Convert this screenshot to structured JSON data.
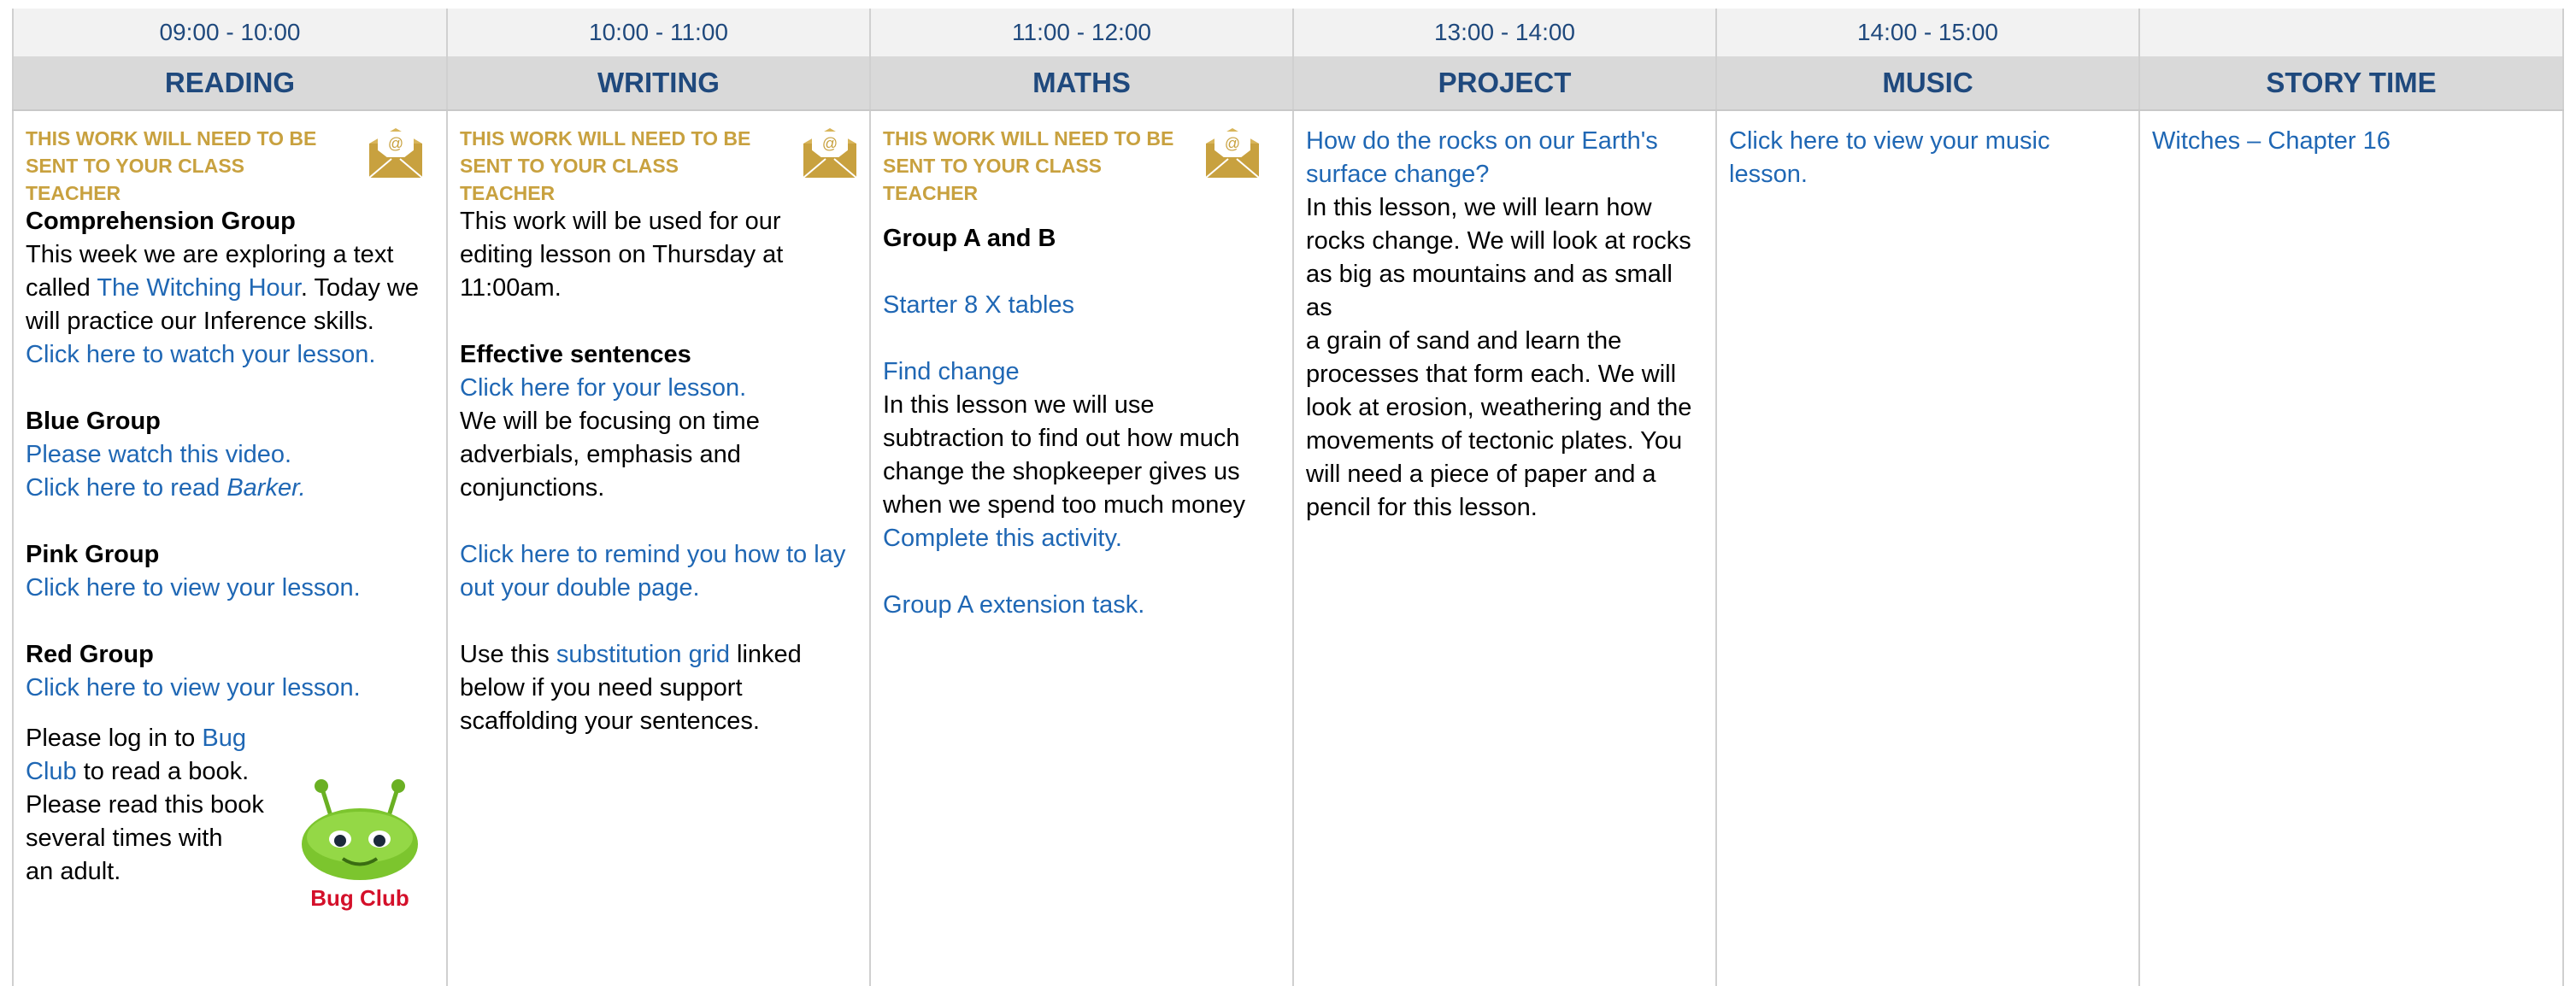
{
  "times": [
    "09:00 - 10:00",
    "10:00 - 11:00",
    "11:00 - 12:00",
    "13:00 - 14:00",
    "14:00 - 15:00",
    ""
  ],
  "subjects": [
    "READING",
    "WRITING",
    "MATHS",
    "PROJECT",
    "MUSIC",
    "STORY TIME"
  ],
  "notice_line1": "THIS WORK WILL NEED TO BE",
  "notice_line2": "SENT TO YOUR CLASS TEACHER",
  "icons": {
    "envelope": "envelope-at-icon",
    "bug_club": "bug-club-logo"
  },
  "colors": {
    "heading": "#1f497d",
    "link": "#1f67b4",
    "notice": "#c8a13f"
  },
  "reading": {
    "comp_title": "Comprehension Group",
    "comp_text1": "This week we are exploring a text",
    "comp_text2a": "called ",
    "comp_link": "The Witching Hour",
    "comp_text2b": ". Today we",
    "comp_text3": "will practice our Inference skills.",
    "comp_lesson": "Click here to watch your lesson.",
    "blue_title": "Blue Group",
    "blue_video": "Please watch this video.",
    "blue_read_a": "Click here to read ",
    "blue_read_b": "Barker.",
    "pink_title": "Pink Group",
    "pink_lesson": "Click here to view your lesson.",
    "red_title": "Red Group",
    "red_lesson": "Click here to view your lesson.",
    "bug_text1": "Please log in to ",
    "bug_link1": "Bug",
    "bug_link2": "Club",
    "bug_text2": " to read a book.",
    "bug_text3": "Please read this book",
    "bug_text4": "several times with",
    "bug_text5": "an adult.",
    "bug_logo_text": "Bug Club"
  },
  "writing": {
    "intro1": "This work will be used for our",
    "intro2": "editing lesson on Thursday at",
    "intro3": "11:00am.",
    "eff_title": "Effective sentences",
    "eff_link": "Click here for your lesson.",
    "eff_text1": "We will be focusing on time",
    "eff_text2": "adverbials, emphasis and",
    "eff_text3": "conjunctions.",
    "remind1": "Click here to remind you how to lay",
    "remind2": "out your double page.",
    "grid_a": "Use this ",
    "grid_link": "substitution grid",
    "grid_b": " linked",
    "grid2": "below if you need support",
    "grid3": "scaffolding your sentences."
  },
  "maths": {
    "group": "Group A and B",
    "starter": "Starter 8 X tables",
    "find": "Find change",
    "t1": "In this lesson we will use",
    "t2": "subtraction to find out how much",
    "t3": "change the shopkeeper gives us",
    "t4": "when we spend too much money",
    "activity": "Complete this activity.",
    "extension": "Group A extension task."
  },
  "project": {
    "q1": "How do the rocks on our Earth's",
    "q2": "surface change?",
    "lines": [
      "In this lesson, we will learn how",
      "rocks change. We will look at rocks",
      "as big as mountains and as small as",
      "a grain of sand and learn the",
      "processes that form each. We will",
      "look at erosion, weathering and the",
      "movements of tectonic plates. You",
      "will need a piece of paper and a",
      "pencil for this lesson."
    ]
  },
  "music": {
    "l1": "Click here to view your music",
    "l2": "lesson."
  },
  "story": {
    "link": "Witches – Chapter 16"
  }
}
